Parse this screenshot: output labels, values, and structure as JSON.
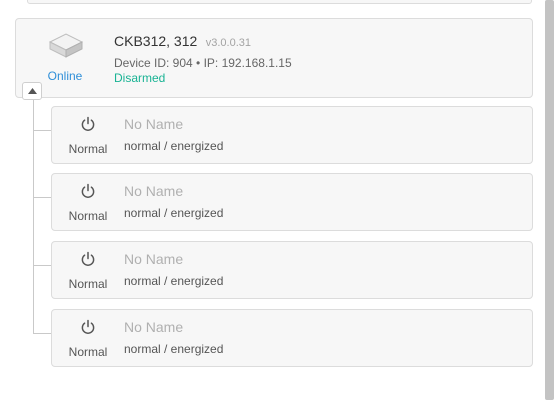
{
  "device": {
    "title": "CKB312, 312",
    "version": "v3.0.0.31",
    "info": "Device ID: 904 • IP: 192.168.1.15",
    "connection_status": "Online",
    "arm_status": "Disarmed",
    "icon": "device-box-icon"
  },
  "outputs": [
    {
      "name": "No Name",
      "state": "Normal",
      "mode": "normal / energized",
      "icon": "power-icon"
    },
    {
      "name": "No Name",
      "state": "Normal",
      "mode": "normal / energized",
      "icon": "power-icon"
    },
    {
      "name": "No Name",
      "state": "Normal",
      "mode": "normal / energized",
      "icon": "power-icon"
    },
    {
      "name": "No Name",
      "state": "Normal",
      "mode": "normal / energized",
      "icon": "power-icon"
    }
  ],
  "colors": {
    "online": "#2f8fd8",
    "disarmed": "#19b394",
    "card_bg": "#f7f7f7",
    "border": "#dcdcdc"
  }
}
